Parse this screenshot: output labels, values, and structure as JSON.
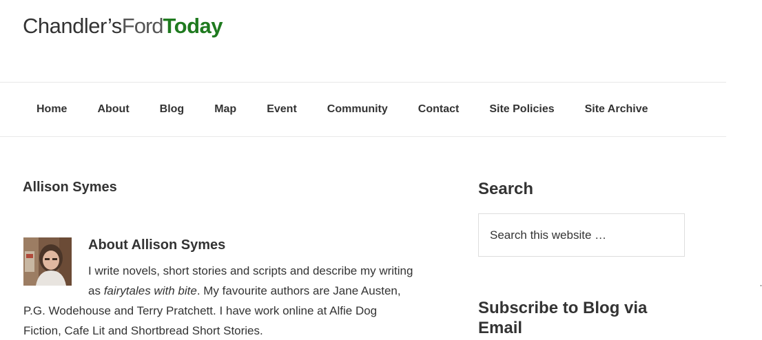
{
  "logo": {
    "part1": "Chandler’s",
    "part2": "Ford",
    "part3": "Today",
    "colors": {
      "primary": "#333333",
      "accent": "#1f7a1f"
    }
  },
  "nav": {
    "items": [
      "Home",
      "About",
      "Blog",
      "Map",
      "Event",
      "Community",
      "Contact",
      "Site Policies",
      "Site Archive"
    ]
  },
  "main": {
    "author_title": "Allison Symes",
    "avatar_icon": "author-photo",
    "about_heading": "About Allison Symes",
    "bio": {
      "line1": "I write novels, short stories and scripts and describe my writing",
      "line2_prefix": "as ",
      "line2_em": "fairytales with bite",
      "line2_suffix": ". My favourite authors are Jane Austen,",
      "line3": "P.G. Wodehouse and Terry Pratchett. I have work online at Alfie Dog",
      "line4": "Fiction, Cafe Lit and Shortbread Short Stories."
    }
  },
  "sidebar": {
    "search_heading": "Search",
    "search_placeholder": "Search this website …",
    "subscribe_heading": "Subscribe to Blog via Email"
  }
}
